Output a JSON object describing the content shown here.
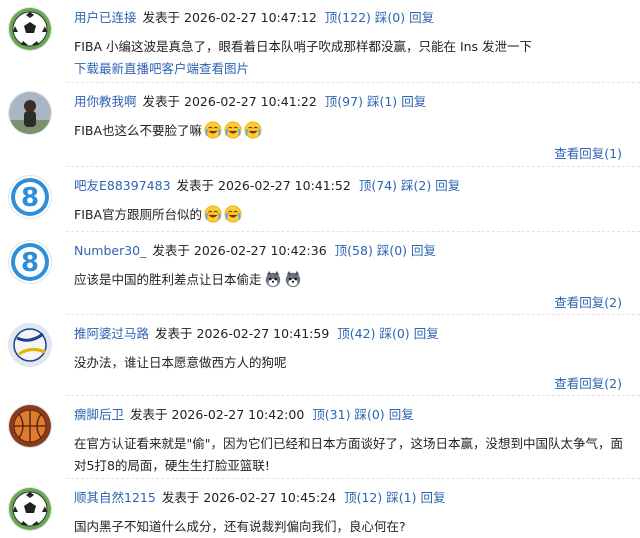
{
  "labels": {
    "posted_prefix": "发表于"
  },
  "comments": [
    {
      "username": "用户已连接",
      "time": "2026-02-27  10:47:12",
      "like": "顶(122)",
      "dislike": "踩(0)",
      "reply": "回复",
      "text": "FIBA 小编这波是真急了，眼看着日本队哨子吹成那样都没赢，只能在 Ins 发泄一下",
      "extra": "下载最新直播吧客户端查看图片",
      "avatar": "soccer-ball-avatar"
    },
    {
      "username": "用你教我啊",
      "time": "2026-02-27  10:41:22",
      "like": "顶(97)",
      "dislike": "踩(1)",
      "reply": "回复",
      "text": "FIBA也这么不要脸了嘛",
      "emoji_count": 3,
      "emoji": "crying-laughing-emoji",
      "view_replies": "查看回复(1)",
      "avatar": "person-photo-avatar"
    },
    {
      "username": "吧友E88397483",
      "time": "2026-02-27  10:41:52",
      "like": "顶(74)",
      "dislike": "踩(2)",
      "reply": "回复",
      "text": "FIBA官方跟厕所台似的",
      "emoji_count": 2,
      "emoji": "crying-laughing-emoji",
      "avatar": "number-8-avatar"
    },
    {
      "username": "Number30_",
      "time": "2026-02-27  10:42:36",
      "like": "顶(58)",
      "dislike": "踩(0)",
      "reply": "回复",
      "text": "应该是中国的胜利差点让日本偷走",
      "emoji_count": 2,
      "emoji": "husky-dog-emoji",
      "view_replies": "查看回复(2)",
      "avatar": "number-8-avatar"
    },
    {
      "username": "推阿婆过马路",
      "time": "2026-02-27  10:41:59",
      "like": "顶(42)",
      "dislike": "踩(0)",
      "reply": "回复",
      "text": "没办法，谁让日本愿意做西方人的狗呢",
      "view_replies": "查看回复(2)",
      "avatar": "volleyball-avatar"
    },
    {
      "username": "瘸脚后卫",
      "time": "2026-02-27  10:42:00",
      "like": "顶(31)",
      "dislike": "踩(0)",
      "reply": "回复",
      "text": "在官方认证看来就是\"偷\"，因为它们已经和日本方面谈好了，这场日本赢，没想到中国队太争气，面对5打8的局面，硬生生打脸亚篮联!",
      "avatar": "basketball-avatar"
    },
    {
      "username": "顺其自然1215",
      "time": "2026-02-27  10:45:24",
      "like": "顶(12)",
      "dislike": "踩(1)",
      "reply": "回复",
      "text": "国内黑子不知道什么成分，还有说裁判偏向我们，良心何在?",
      "avatar": "soccer-ball-avatar"
    }
  ]
}
